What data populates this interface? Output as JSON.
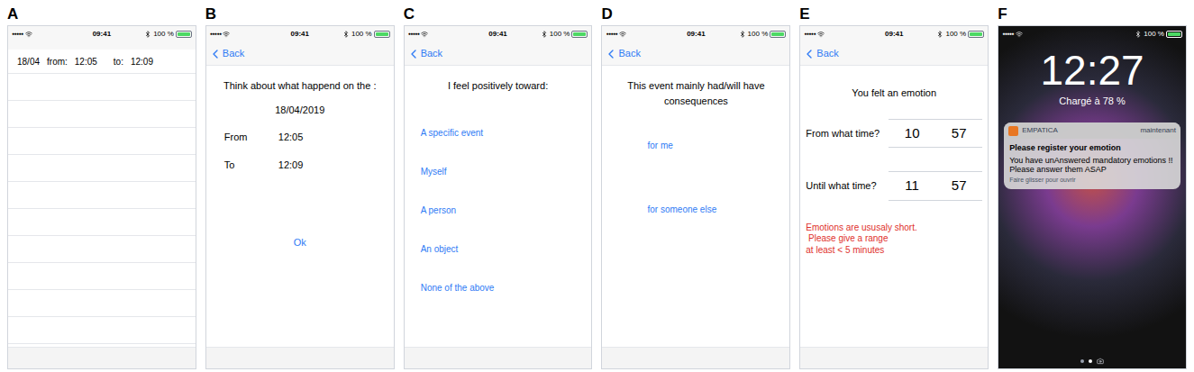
{
  "panels": [
    {
      "label": "A",
      "kind": "list",
      "status_bar": {
        "signal": "●●●●●",
        "time": "09:41",
        "battery": "100 %",
        "battery_level": 1
      },
      "entry": {
        "date": "18/04",
        "from_label": "from:",
        "from": "12:05",
        "to_label": "to:",
        "to": "12:09"
      }
    },
    {
      "label": "B",
      "kind": "info",
      "status_bar": {
        "signal": "●●●●●",
        "time": "09:41",
        "battery": "100 %",
        "battery_level": 1
      },
      "back": "Back",
      "prompt": "Think about what happend on the :",
      "date": "18/04/2019",
      "rows": [
        {
          "label": "From",
          "value": "12:05"
        },
        {
          "label": "To",
          "value": "12:09"
        }
      ],
      "button": "Ok"
    },
    {
      "label": "C",
      "kind": "choice",
      "status_bar": {
        "signal": "●●●●●",
        "time": "09:41",
        "battery": "100 %",
        "battery_level": 1
      },
      "back": "Back",
      "question": "I feel positively toward:",
      "options": [
        "A specific event",
        "Myself",
        "A person",
        "An object",
        "None of the above"
      ]
    },
    {
      "label": "D",
      "kind": "choice",
      "status_bar": {
        "signal": "●●●●●",
        "time": "09:41",
        "battery": "100 %",
        "battery_level": 1
      },
      "back": "Back",
      "question": "This event mainly had/will have consequences",
      "options": [
        "for me",
        "for someone else"
      ]
    },
    {
      "label": "E",
      "kind": "time-picker",
      "status_bar": {
        "signal": "●●●●●",
        "time": "09:41",
        "battery": "100 %",
        "battery_level": 1
      },
      "back": "Back",
      "title": "You felt an emotion",
      "pickers": [
        {
          "label": "From what time?",
          "hour": "10",
          "minute": "57"
        },
        {
          "label": "Until what time?",
          "hour": "11",
          "minute": "57"
        }
      ],
      "warning": [
        "Emotions are ususaly short.",
        " Please give a range",
        "at least < 5 minutes"
      ]
    },
    {
      "label": "F",
      "kind": "lock-screen",
      "status_bar": {
        "signal": "●●●●●",
        "battery": "100 %",
        "battery_level": 1
      },
      "time": "12:27",
      "charging": "Chargé à 78 %",
      "notification": {
        "app": "EMPATICA",
        "when": "maintenant",
        "title": "Please register your emotion",
        "body": "You have unAnswered mandatory emotions !! Please answer them ASAP",
        "hint": "Faire glisser pour ouvrir"
      },
      "pages": [
        {
          "selected": false
        },
        {
          "selected": true
        }
      ]
    }
  ]
}
